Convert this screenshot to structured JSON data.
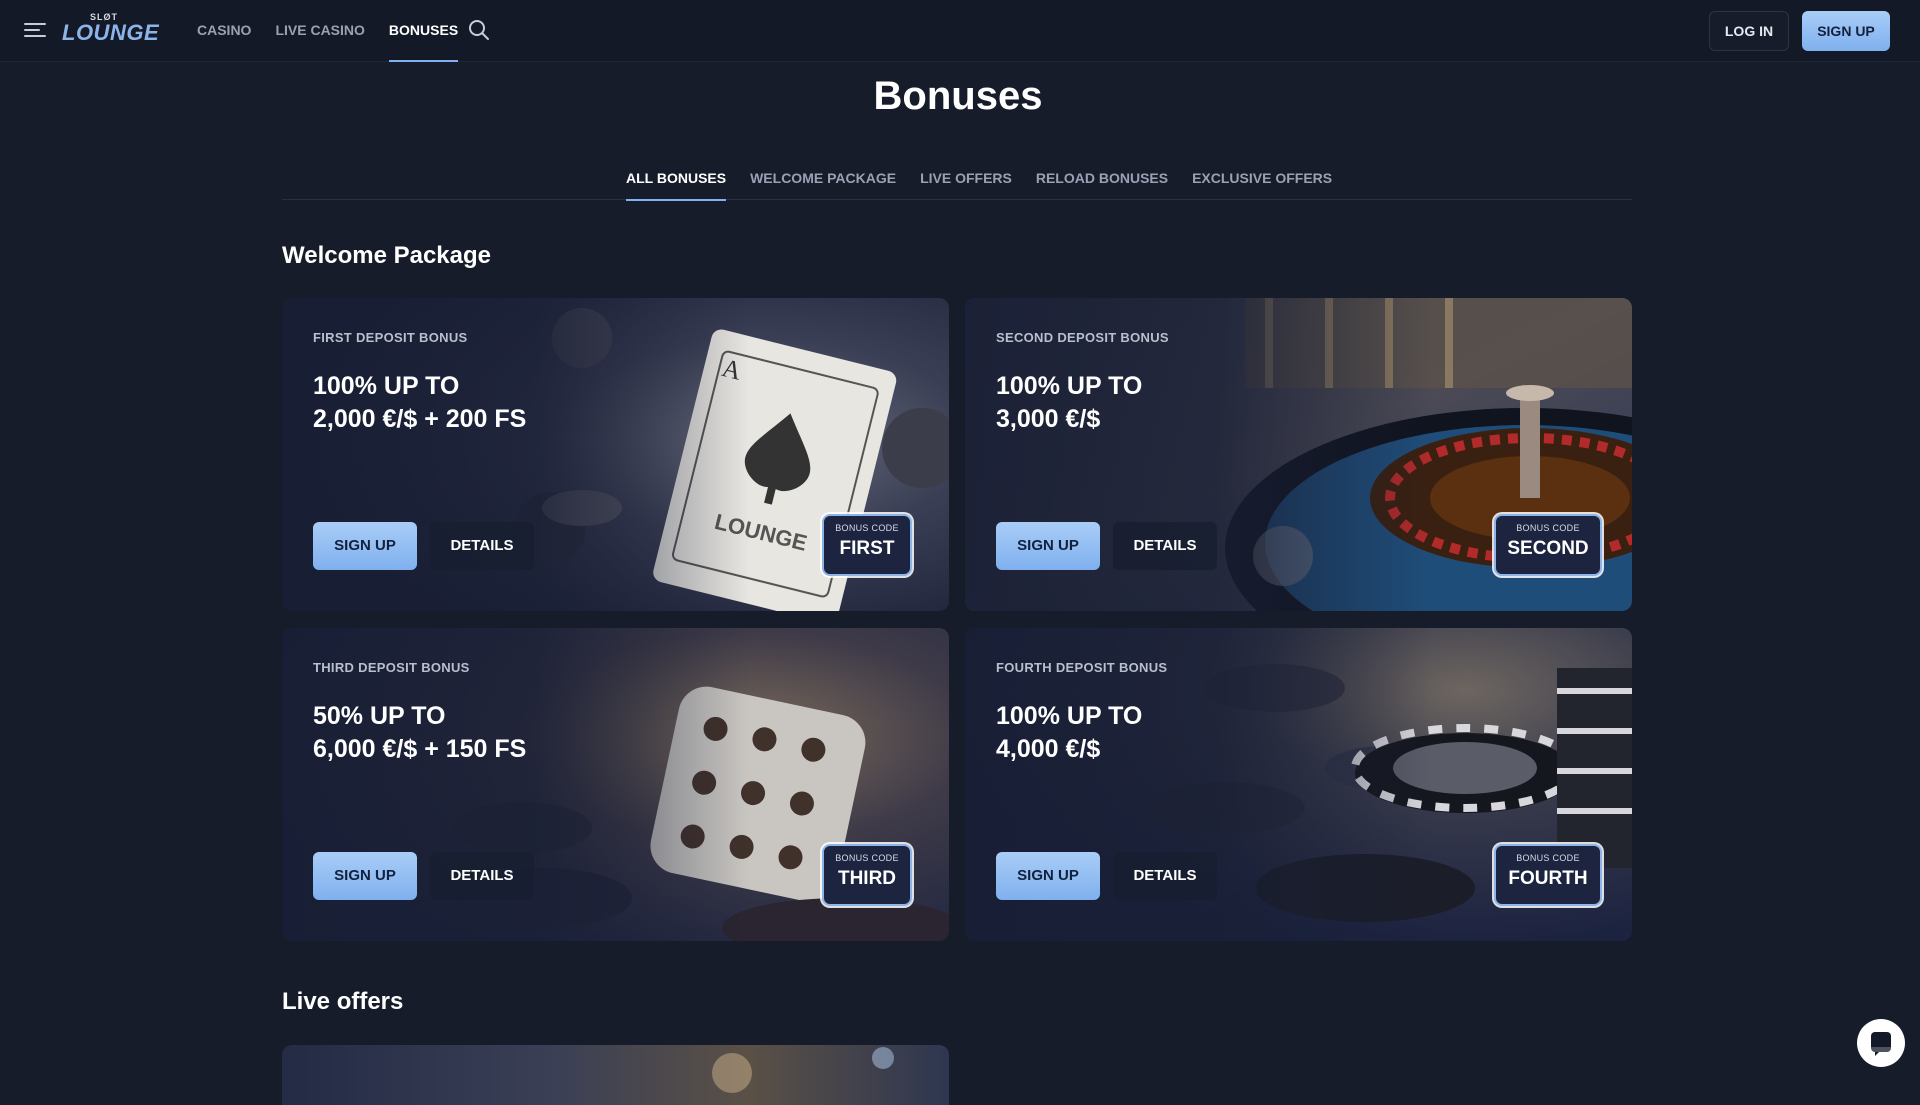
{
  "header": {
    "logo_top": "SLØT",
    "logo_main": "LOUNGE",
    "nav": [
      {
        "label": "CASINO"
      },
      {
        "label": "LIVE CASINO"
      },
      {
        "label": "BONUSES"
      }
    ],
    "active_nav": "BONUSES",
    "login_label": "LOG IN",
    "signup_label": "SIGN UP"
  },
  "page": {
    "title": "Bonuses",
    "tabs": [
      {
        "label": "ALL BONUSES"
      },
      {
        "label": "WELCOME PACKAGE"
      },
      {
        "label": "LIVE OFFERS"
      },
      {
        "label": "RELOAD BONUSES"
      },
      {
        "label": "EXCLUSIVE OFFERS"
      }
    ],
    "active_tab": "ALL BONUSES"
  },
  "welcome": {
    "title": "Welcome Package",
    "cards": [
      {
        "eyebrow": "FIRST DEPOSIT BONUS",
        "line1": "100% UP TO",
        "line2": "2,000 €/$ + 200 FS",
        "signup": "SIGN UP",
        "details": "DETAILS",
        "code_label": "BONUS CODE",
        "code": "FIRST",
        "art": "playing-card"
      },
      {
        "eyebrow": "SECOND DEPOSIT BONUS",
        "line1": "100% UP TO",
        "line2": "3,000 €/$",
        "signup": "SIGN UP",
        "details": "DETAILS",
        "code_label": "BONUS CODE",
        "code": "SECOND",
        "art": "roulette-wheel"
      },
      {
        "eyebrow": "THIRD DEPOSIT BONUS",
        "line1": "50% UP TO",
        "line2": "6,000 €/$ + 150 FS",
        "signup": "SIGN UP",
        "details": "DETAILS",
        "code_label": "BONUS CODE",
        "code": "THIRD",
        "art": "dice"
      },
      {
        "eyebrow": "FOURTH DEPOSIT BONUS",
        "line1": "100% UP TO",
        "line2": "4,000 €/$",
        "signup": "SIGN UP",
        "details": "DETAILS",
        "code_label": "BONUS CODE",
        "code": "FOURTH",
        "art": "poker-chips"
      }
    ]
  },
  "live_offers": {
    "title": "Live offers"
  },
  "colors": {
    "background": "#171c2b",
    "accent": "#8db4e8",
    "button_primary": "#a9cdf7"
  },
  "icons": {
    "menu": "hamburger-menu-icon",
    "search": "search-icon",
    "chat": "chat-icon"
  }
}
